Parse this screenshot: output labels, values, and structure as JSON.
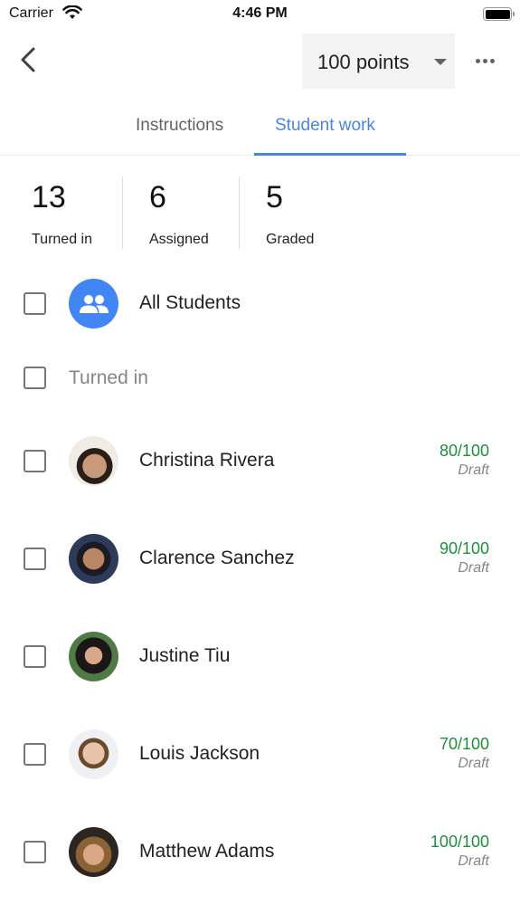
{
  "status_bar": {
    "carrier": "Carrier",
    "time": "4:46 PM",
    "wifi_icon": "wifi-icon",
    "battery_icon": "battery-icon",
    "battery_level": 1.0
  },
  "toolbar": {
    "back_icon": "chevron-left-icon",
    "points_label": "100 points",
    "points_caret_icon": "caret-down-icon",
    "more_icon": "more-horizontal-icon"
  },
  "tabs": [
    {
      "label": "Instructions",
      "active": false
    },
    {
      "label": "Student work",
      "active": true
    }
  ],
  "colors": {
    "accent": "#4a86d8",
    "avatar_blue": "#4285f4",
    "grade_green": "#1e8e3e",
    "muted_gray": "#80868b"
  },
  "stats": [
    {
      "value": "13",
      "label": "Turned in"
    },
    {
      "value": "6",
      "label": "Assigned"
    },
    {
      "value": "5",
      "label": "Graded"
    }
  ],
  "all_students": {
    "label": "All Students",
    "icon": "people-icon"
  },
  "section": {
    "label": "Turned in"
  },
  "students": [
    {
      "name": "Christina Rivera",
      "score": "80/100",
      "status": "Draft"
    },
    {
      "name": "Clarence Sanchez",
      "score": "90/100",
      "status": "Draft"
    },
    {
      "name": "Justine Tiu",
      "score": "",
      "status": ""
    },
    {
      "name": "Louis Jackson",
      "score": "70/100",
      "status": "Draft"
    },
    {
      "name": "Matthew Adams",
      "score": "100/100",
      "status": "Draft"
    }
  ]
}
